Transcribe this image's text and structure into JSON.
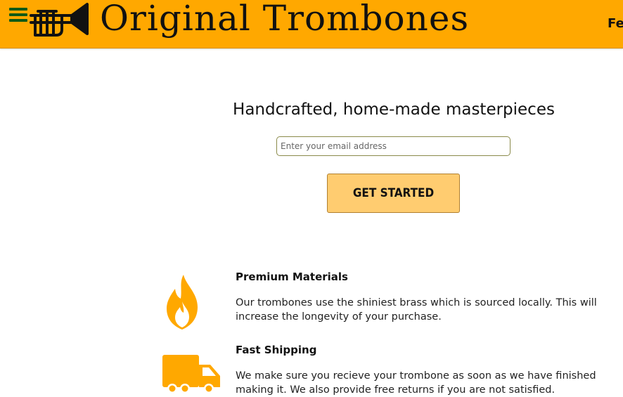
{
  "header": {
    "brand": "Original Trombones",
    "nav_partial": "Fea",
    "colors": {
      "bar": "#ffa800",
      "menu_icon": "#0f5a16"
    },
    "menu_icon": "hamburger-menu-icon",
    "logo_icon": "trombone-logo-icon"
  },
  "hero": {
    "headline": "Handcrafted, home-made masterpieces",
    "email_placeholder": "Enter your email address",
    "email_value": "",
    "cta_label": "GET STARTED",
    "cta_color": "#ffcc70"
  },
  "features": [
    {
      "icon": "flame-icon",
      "title": "Premium Materials",
      "description": "Our trombones use the shiniest brass which is sourced locally. This will increase the longevity of your purchase."
    },
    {
      "icon": "truck-icon",
      "title": "Fast Shipping",
      "description": "We make sure you recieve your trombone as soon as we have finished making it. We also provide free returns if you are not satisfied."
    }
  ],
  "accent_color": "#ffa800"
}
